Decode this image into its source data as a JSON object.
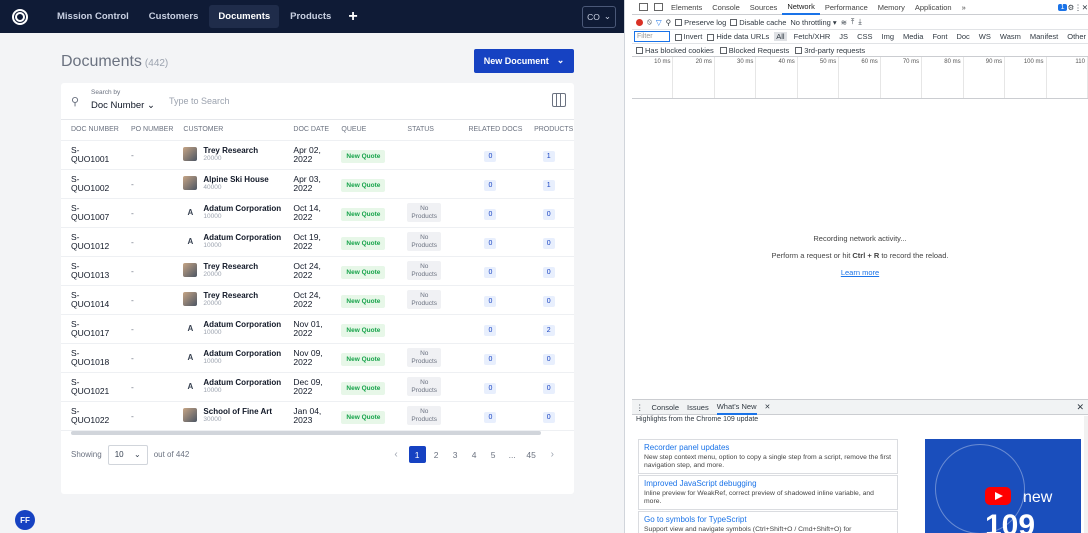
{
  "nav": {
    "items": [
      "Mission Control",
      "Customers",
      "Documents",
      "Products"
    ],
    "active": "Documents",
    "plus": "+",
    "user": "CO"
  },
  "page": {
    "title": "Documents",
    "count": "(442)",
    "new_button": "New Document"
  },
  "search": {
    "by_label": "Search by",
    "by_value": "Doc Number",
    "placeholder": "Type to Search"
  },
  "table": {
    "headers": [
      "DOC NUMBER",
      "PO NUMBER",
      "CUSTOMER",
      "DOC DATE",
      "QUEUE",
      "STATUS",
      "RELATED DOCS",
      "PRODUCTS"
    ],
    "rows": [
      {
        "doc1": "S-",
        "doc2": "QUO1001",
        "po": "-",
        "avatar": "photo",
        "customer": "Trey Research",
        "cnum": "20000",
        "date1": "Apr 02,",
        "date2": "2022",
        "queue": "New Quote",
        "status1": "",
        "status2": "",
        "related": "0",
        "products": "1"
      },
      {
        "doc1": "S-",
        "doc2": "QUO1002",
        "po": "-",
        "avatar": "photo",
        "customer": "Alpine Ski House",
        "cnum": "40000",
        "date1": "Apr 03,",
        "date2": "2022",
        "queue": "New Quote",
        "status1": "",
        "status2": "",
        "related": "0",
        "products": "1"
      },
      {
        "doc1": "S-",
        "doc2": "QUO1007",
        "po": "-",
        "avatar": "A",
        "customer": "Adatum Corporation",
        "cnum": "10000",
        "date1": "Oct 14,",
        "date2": "2022",
        "queue": "New Quote",
        "status1": "No",
        "status2": "Products",
        "related": "0",
        "products": "0"
      },
      {
        "doc1": "S-",
        "doc2": "QUO1012",
        "po": "-",
        "avatar": "A",
        "customer": "Adatum Corporation",
        "cnum": "10000",
        "date1": "Oct 19,",
        "date2": "2022",
        "queue": "New Quote",
        "status1": "No",
        "status2": "Products",
        "related": "0",
        "products": "0"
      },
      {
        "doc1": "S-",
        "doc2": "QUO1013",
        "po": "-",
        "avatar": "photo",
        "customer": "Trey Research",
        "cnum": "20000",
        "date1": "Oct 24,",
        "date2": "2022",
        "queue": "New Quote",
        "status1": "No",
        "status2": "Products",
        "related": "0",
        "products": "0"
      },
      {
        "doc1": "S-",
        "doc2": "QUO1014",
        "po": "-",
        "avatar": "photo",
        "customer": "Trey Research",
        "cnum": "20000",
        "date1": "Oct 24,",
        "date2": "2022",
        "queue": "New Quote",
        "status1": "No",
        "status2": "Products",
        "related": "0",
        "products": "0"
      },
      {
        "doc1": "S-",
        "doc2": "QUO1017",
        "po": "-",
        "avatar": "A",
        "customer": "Adatum Corporation",
        "cnum": "10000",
        "date1": "Nov 01,",
        "date2": "2022",
        "queue": "New Quote",
        "status1": "",
        "status2": "",
        "related": "0",
        "products": "2"
      },
      {
        "doc1": "S-",
        "doc2": "QUO1018",
        "po": "-",
        "avatar": "A",
        "customer": "Adatum Corporation",
        "cnum": "10000",
        "date1": "Nov 09,",
        "date2": "2022",
        "queue": "New Quote",
        "status1": "No",
        "status2": "Products",
        "related": "0",
        "products": "0"
      },
      {
        "doc1": "S-",
        "doc2": "QUO1021",
        "po": "-",
        "avatar": "A",
        "customer": "Adatum Corporation",
        "cnum": "10000",
        "date1": "Dec 09,",
        "date2": "2022",
        "queue": "New Quote",
        "status1": "No",
        "status2": "Products",
        "related": "0",
        "products": "0"
      },
      {
        "doc1": "S-",
        "doc2": "QUO1022",
        "po": "-",
        "avatar": "photo",
        "customer": "School of Fine Art",
        "cnum": "30000",
        "date1": "Jan 04,",
        "date2": "2023",
        "queue": "New Quote",
        "status1": "No",
        "status2": "Products",
        "related": "0",
        "products": "0"
      }
    ]
  },
  "pager": {
    "showing": "Showing",
    "page_size": "10",
    "out_of": "out of 442",
    "pages": [
      "1",
      "2",
      "3",
      "4",
      "5",
      "...",
      "45"
    ],
    "current": "1"
  },
  "user_badge": "FF",
  "devtools": {
    "tabs": [
      "Elements",
      "Console",
      "Sources",
      "Network",
      "Performance",
      "Memory",
      "Application",
      "»"
    ],
    "active_tab": "Network",
    "issues_badge": "1",
    "toolbar": {
      "preserve_log": "Preserve log",
      "disable_cache": "Disable cache",
      "throttle": "No throttling"
    },
    "filter_placeholder": "Filter",
    "filter_opts": [
      "Invert",
      "Hide data URLs"
    ],
    "types": [
      "All",
      "Fetch/XHR",
      "JS",
      "CSS",
      "Img",
      "Media",
      "Font",
      "Doc",
      "WS",
      "Wasm",
      "Manifest",
      "Other"
    ],
    "options": [
      "Has blocked cookies",
      "Blocked Requests",
      "3rd-party requests"
    ],
    "ticks": [
      "10 ms",
      "20 ms",
      "30 ms",
      "40 ms",
      "50 ms",
      "60 ms",
      "70 ms",
      "80 ms",
      "90 ms",
      "100 ms",
      "110"
    ],
    "recording": "Recording network activity...",
    "hint_pre": "Perform a request or hit ",
    "hint_key": "Ctrl + R",
    "hint_post": " to record the reload.",
    "learn_more": "Learn more",
    "drawer_tabs": [
      "Console",
      "Issues",
      "What's New"
    ],
    "highlights": "Highlights from the Chrome 109 update",
    "whatsnew": [
      {
        "title": "Recorder panel updates",
        "body": "New step context menu, option to copy a single step from a script, remove the first navigation step, and more."
      },
      {
        "title": "Improved JavaScript debugging",
        "body": "Inline preview for WeakRef, correct preview of shadowed inline variable, and more."
      },
      {
        "title": "Go to symbols for TypeScript",
        "body": "Support view and navigate symbols (Ctrl+Shift+O / Cmd+Shift+O) for"
      }
    ],
    "promo_new": "new",
    "promo_num": "109"
  }
}
